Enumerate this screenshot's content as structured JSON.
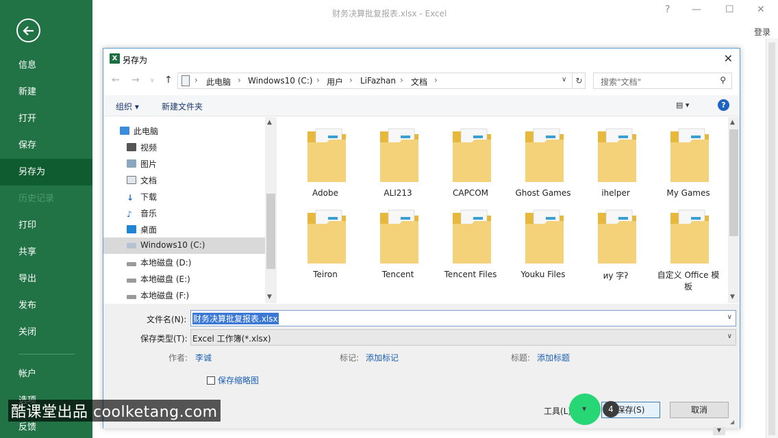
{
  "excel": {
    "window_title": "财务决算批复报表.xlsx - Excel",
    "help_glyph": "?",
    "login_label": "登录"
  },
  "backstage": {
    "items": [
      {
        "label": "信息"
      },
      {
        "label": "新建"
      },
      {
        "label": "打开"
      },
      {
        "label": "保存"
      },
      {
        "label": "另存为"
      },
      {
        "label": "历史记录"
      },
      {
        "label": "打印"
      },
      {
        "label": "共享"
      },
      {
        "label": "导出"
      },
      {
        "label": "发布"
      },
      {
        "label": "关闭"
      },
      {
        "label": "帐户"
      },
      {
        "label": "选项"
      },
      {
        "label": "反馈"
      }
    ]
  },
  "dialog": {
    "title": "另存为",
    "breadcrumbs": [
      "此电脑",
      "Windows10 (C:)",
      "用户",
      "LiFazhan",
      "文档"
    ],
    "search_placeholder": "搜索\"文档\"",
    "toolbar": {
      "organize_label": "组织",
      "new_folder_label": "新建文件夹"
    },
    "nav_tree": [
      {
        "label": "此电脑",
        "icon": "pc-icon"
      },
      {
        "label": "视频",
        "icon": "video-icon"
      },
      {
        "label": "图片",
        "icon": "pictures-icon"
      },
      {
        "label": "文档",
        "icon": "documents-icon"
      },
      {
        "label": "下载",
        "icon": "download-icon"
      },
      {
        "label": "音乐",
        "icon": "music-icon"
      },
      {
        "label": "桌面",
        "icon": "desktop-icon"
      },
      {
        "label": "Windows10 (C:)",
        "icon": "drive-icon"
      },
      {
        "label": "本地磁盘 (D:)",
        "icon": "drive-icon"
      },
      {
        "label": "本地磁盘 (E:)",
        "icon": "drive-icon"
      },
      {
        "label": "本地磁盘 (F:)",
        "icon": "drive-icon"
      }
    ],
    "folders": [
      {
        "label": "Adobe"
      },
      {
        "label": "ALI213"
      },
      {
        "label": "CAPCOM"
      },
      {
        "label": "Ghost Games"
      },
      {
        "label": "ihelper"
      },
      {
        "label": "My Games"
      },
      {
        "label": "Teiron"
      },
      {
        "label": "Tencent"
      },
      {
        "label": "Tencent Files"
      },
      {
        "label": "Youku Files"
      },
      {
        "label": "иу 字ʔ"
      },
      {
        "label": "自定义 Office 模板"
      }
    ],
    "form": {
      "filename_label": "文件名(N):",
      "filename_value": "财务决算批复报表.xlsx",
      "filetype_label": "保存类型(T):",
      "filetype_value": "Excel 工作簿(*.xlsx)",
      "author_label": "作者:",
      "author_value": "李诚",
      "tags_label": "标记:",
      "tags_value": "添加标记",
      "title_label": "标题:",
      "title_value": "添加标题",
      "thumbnail_label": "保存缩略图",
      "tools_label": "工具(L)",
      "save_label": "保存(S)",
      "cancel_label": "取消"
    }
  },
  "overlay": {
    "step_number": "4",
    "watermark": "酷课堂出品 coolketang.com"
  }
}
